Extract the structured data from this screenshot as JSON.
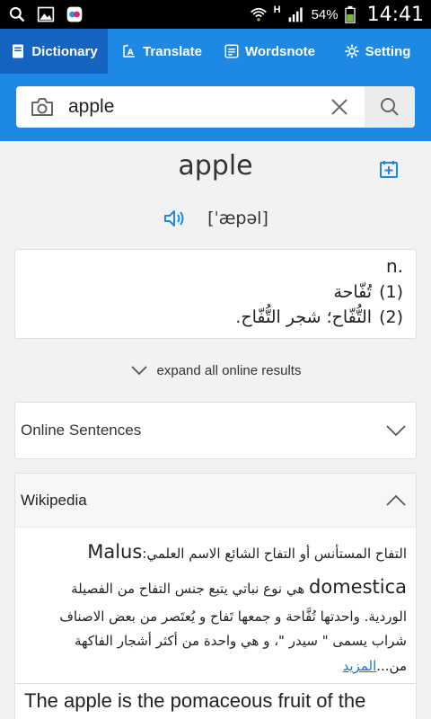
{
  "status": {
    "network": "H",
    "battery": "54%",
    "time": "14:41"
  },
  "tabs": [
    {
      "label": "Dictionary",
      "active": true
    },
    {
      "label": "Translate",
      "active": false
    },
    {
      "label": "Wordsnote",
      "active": false
    },
    {
      "label": "Setting",
      "active": false
    }
  ],
  "search": {
    "value": "apple"
  },
  "entry": {
    "word": "apple",
    "phonetic": "[ˈæpəl]",
    "pos": "n.",
    "defs": [
      {
        "num": "(1)",
        "text": "تُفّاحة"
      },
      {
        "num": "(2)",
        "text": "التُّفّاح؛ شجر التُّفّاح."
      }
    ]
  },
  "expand_label": "expand all online results",
  "online_sentences": {
    "label": "Online Sentences"
  },
  "wikipedia": {
    "label": "Wikipedia",
    "text_a": "التفاح المستأنس أو التفاح الشائع الاسم العلمي:",
    "latin_name": "Malus domestica",
    "text_b": " هي نوع نباتي يتبع جنس التفاح من الفصيلة الوردية. واحدتها تُفَّاحة و جمعها تَفاح و يُعتَصر من بعض الاصناف شراب يسمى \" سيدر \"، و هي واحدة من أكثر أشجار الفاكهة من...",
    "more_link": "المزيد"
  },
  "english_card": {
    "text": "The apple is the pomaceous fruit of the"
  },
  "colors": {
    "primary": "#1e88e5",
    "primary_dark": "#1565c0",
    "link": "#1976d2"
  }
}
